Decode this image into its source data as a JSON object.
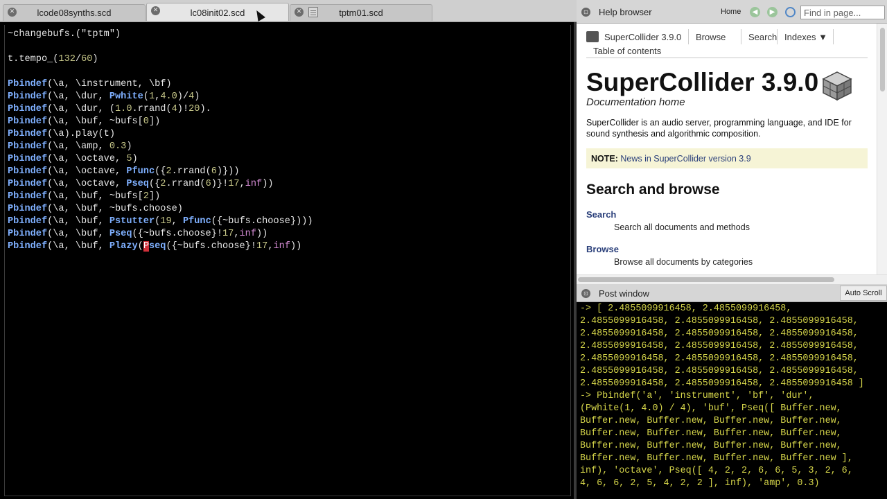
{
  "tabs": [
    {
      "label": "lcode08synths.scd",
      "active": false
    },
    {
      "label": "lc08init02.scd",
      "active": true
    },
    {
      "label": "tptm01.scd",
      "active": false
    }
  ],
  "editor": {
    "lines": [
      [
        {
          "t": "~changebufs.(\"tptm\")",
          "c": "text"
        }
      ],
      [],
      [
        {
          "t": "t.tempo_(",
          "c": "text"
        },
        {
          "t": "132",
          "c": "num"
        },
        {
          "t": "/",
          "c": "text"
        },
        {
          "t": "60",
          "c": "num"
        },
        {
          "t": ")",
          "c": "text"
        }
      ],
      [],
      [
        {
          "t": "Pbindef",
          "c": "class"
        },
        {
          "t": "(\\a, \\instrument, \\bf)",
          "c": "text"
        }
      ],
      [
        {
          "t": "Pbindef",
          "c": "class"
        },
        {
          "t": "(\\a, \\dur, ",
          "c": "text"
        },
        {
          "t": "Pwhite",
          "c": "class"
        },
        {
          "t": "(",
          "c": "text"
        },
        {
          "t": "1",
          "c": "num"
        },
        {
          "t": ",",
          "c": "text"
        },
        {
          "t": "4.0",
          "c": "num"
        },
        {
          "t": ")/",
          "c": "text"
        },
        {
          "t": "4",
          "c": "num"
        },
        {
          "t": ")",
          "c": "text"
        }
      ],
      [
        {
          "t": "Pbindef",
          "c": "class"
        },
        {
          "t": "(\\a, \\dur, (",
          "c": "text"
        },
        {
          "t": "1.0",
          "c": "num"
        },
        {
          "t": ".rrand(",
          "c": "text"
        },
        {
          "t": "4",
          "c": "num"
        },
        {
          "t": ")!",
          "c": "text"
        },
        {
          "t": "20",
          "c": "num"
        },
        {
          "t": ").",
          "c": "text"
        }
      ],
      [
        {
          "t": "Pbindef",
          "c": "class"
        },
        {
          "t": "(\\a, \\buf, ~bufs[",
          "c": "text"
        },
        {
          "t": "0",
          "c": "num"
        },
        {
          "t": "])",
          "c": "text"
        }
      ],
      [
        {
          "t": "Pbindef",
          "c": "class"
        },
        {
          "t": "(\\a).play(t)",
          "c": "text"
        }
      ],
      [
        {
          "t": "Pbindef",
          "c": "class"
        },
        {
          "t": "(\\a, \\amp, ",
          "c": "text"
        },
        {
          "t": "0.3",
          "c": "num"
        },
        {
          "t": ")",
          "c": "text"
        }
      ],
      [
        {
          "t": "Pbindef",
          "c": "class"
        },
        {
          "t": "(\\a, \\octave, ",
          "c": "text"
        },
        {
          "t": "5",
          "c": "num"
        },
        {
          "t": ")",
          "c": "text"
        }
      ],
      [
        {
          "t": "Pbindef",
          "c": "class"
        },
        {
          "t": "(\\a, \\octave, ",
          "c": "text"
        },
        {
          "t": "Pfunc",
          "c": "class"
        },
        {
          "t": "({",
          "c": "text"
        },
        {
          "t": "2",
          "c": "num"
        },
        {
          "t": ".rrand(",
          "c": "text"
        },
        {
          "t": "6",
          "c": "num"
        },
        {
          "t": ")}))",
          "c": "text"
        }
      ],
      [
        {
          "t": "Pbindef",
          "c": "class"
        },
        {
          "t": "(\\a, \\octave, ",
          "c": "text"
        },
        {
          "t": "Pseq",
          "c": "class"
        },
        {
          "t": "({",
          "c": "text"
        },
        {
          "t": "2",
          "c": "num"
        },
        {
          "t": ".rrand(",
          "c": "text"
        },
        {
          "t": "6",
          "c": "num"
        },
        {
          "t": ")}!",
          "c": "text"
        },
        {
          "t": "17",
          "c": "num"
        },
        {
          "t": ",",
          "c": "text"
        },
        {
          "t": "inf",
          "c": "kw"
        },
        {
          "t": "))",
          "c": "text"
        }
      ],
      [
        {
          "t": "Pbindef",
          "c": "class"
        },
        {
          "t": "(\\a, \\buf, ~bufs[",
          "c": "text"
        },
        {
          "t": "2",
          "c": "num"
        },
        {
          "t": "])",
          "c": "text"
        }
      ],
      [
        {
          "t": "Pbindef",
          "c": "class"
        },
        {
          "t": "(\\a, \\buf, ~bufs.choose)",
          "c": "text"
        }
      ],
      [
        {
          "t": "Pbindef",
          "c": "class"
        },
        {
          "t": "(\\a, \\buf, ",
          "c": "text"
        },
        {
          "t": "Pstutter",
          "c": "class"
        },
        {
          "t": "(",
          "c": "text"
        },
        {
          "t": "19",
          "c": "num"
        },
        {
          "t": ", ",
          "c": "text"
        },
        {
          "t": "Pfunc",
          "c": "class"
        },
        {
          "t": "({~bufs.choose})))",
          "c": "text"
        }
      ],
      [
        {
          "t": "Pbindef",
          "c": "class"
        },
        {
          "t": "(\\a, \\buf, ",
          "c": "text"
        },
        {
          "t": "Pseq",
          "c": "class"
        },
        {
          "t": "({~bufs.choose}!",
          "c": "text"
        },
        {
          "t": "17",
          "c": "num"
        },
        {
          "t": ",",
          "c": "text"
        },
        {
          "t": "inf",
          "c": "kw"
        },
        {
          "t": "))",
          "c": "text"
        }
      ],
      [
        {
          "t": "Pbindef",
          "c": "class"
        },
        {
          "t": "(\\a, \\buf, ",
          "c": "text"
        },
        {
          "t": "Plazy",
          "c": "class"
        },
        {
          "t": "(",
          "c": "text"
        },
        {
          "t": "P",
          "c": "cursor"
        },
        {
          "t": "seq",
          "c": "class"
        },
        {
          "t": "({~bufs.choose}!",
          "c": "text"
        },
        {
          "t": "17",
          "c": "num"
        },
        {
          "t": ",",
          "c": "text"
        },
        {
          "t": "inf",
          "c": "kw"
        },
        {
          "t": "))",
          "c": "text"
        }
      ]
    ]
  },
  "help": {
    "dock_title": "Help browser",
    "home_label": "Home",
    "find_placeholder": "Find in page...",
    "nav": {
      "version": "SuperCollider 3.9.0",
      "browse": "Browse",
      "search": "Search",
      "indexes": "Indexes ▼",
      "toc": "Table of contents"
    },
    "title": "SuperCollider 3.9.0",
    "subtitle": "Documentation home",
    "description": "SuperCollider is an audio server, programming language, and IDE for sound synthesis and algorithmic composition.",
    "note_label": "NOTE:",
    "note_link": "News in SuperCollider version 3.9",
    "section_title": "Search and browse",
    "links": [
      {
        "label": "Search",
        "desc": "Search all documents and methods"
      },
      {
        "label": "Browse",
        "desc": "Browse all documents by categories"
      }
    ]
  },
  "post": {
    "dock_title": "Post window",
    "autoscroll_label": "Auto Scroll",
    "lines": [
      "-> [ 2.4855099916458, 2.4855099916458,",
      "2.4855099916458, 2.4855099916458, 2.4855099916458,",
      "2.4855099916458, 2.4855099916458, 2.4855099916458,",
      "2.4855099916458, 2.4855099916458, 2.4855099916458,",
      "2.4855099916458, 2.4855099916458, 2.4855099916458,",
      "2.4855099916458, 2.4855099916458, 2.4855099916458,",
      "2.4855099916458, 2.4855099916458, 2.4855099916458 ]",
      "-> Pbindef('a', 'instrument', 'bf', 'dur',",
      "(Pwhite(1, 4.0) / 4), 'buf', Pseq([ Buffer.new,",
      "Buffer.new, Buffer.new, Buffer.new, Buffer.new,",
      "Buffer.new, Buffer.new, Buffer.new, Buffer.new,",
      "Buffer.new, Buffer.new, Buffer.new, Buffer.new,",
      "Buffer.new, Buffer.new, Buffer.new, Buffer.new ],",
      "inf), 'octave', Pseq([ 4, 2, 2, 6, 6, 5, 3, 2, 6,",
      "4, 6, 6, 2, 5, 4, 2, 2 ], inf), 'amp', 0.3)"
    ]
  }
}
